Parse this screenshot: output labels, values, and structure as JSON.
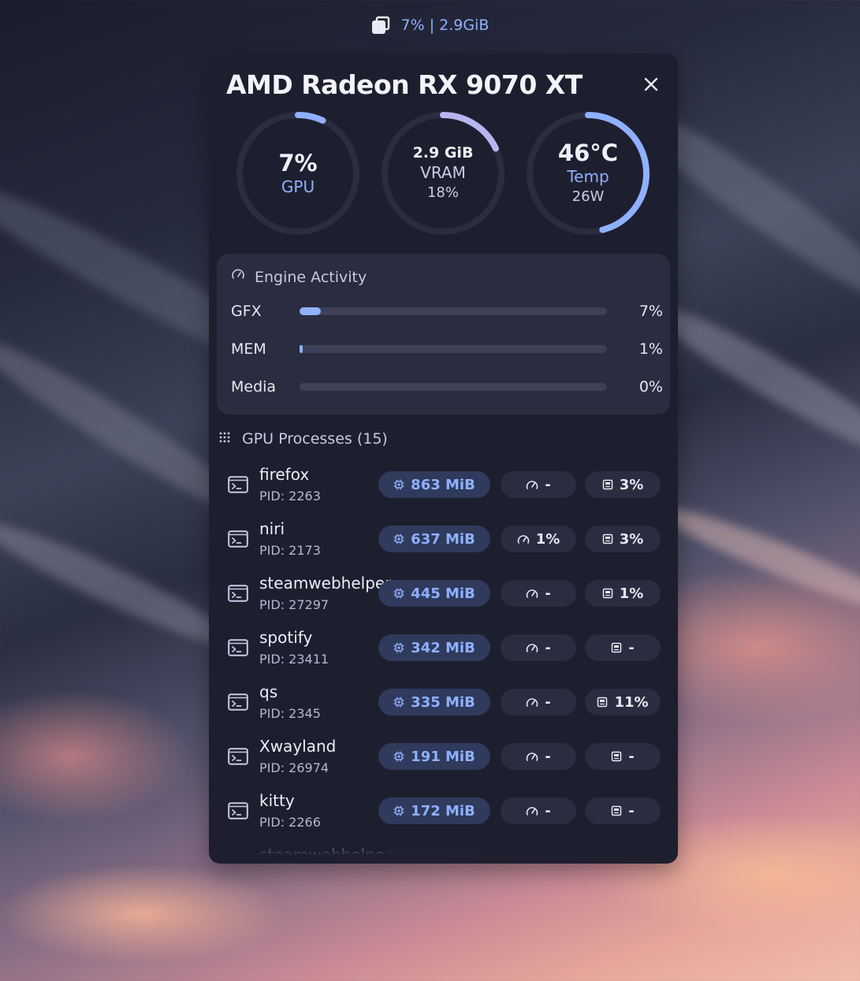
{
  "topbar": {
    "icon": "copy-window-icon",
    "text": "7% | 2.9GiB"
  },
  "panel": {
    "title": "AMD Radeon RX 9070 XT",
    "close_icon": "close-icon"
  },
  "gauges": [
    {
      "value": "7%",
      "label": "GPU",
      "fraction": 0.07
    },
    {
      "value": "2.9 GiB",
      "label": "VRAM",
      "sub": "18%",
      "fraction": 0.18
    },
    {
      "value": "46°C",
      "label": "Temp",
      "sub": "26W",
      "fraction": 0.46
    }
  ],
  "engine": {
    "title": "Engine Activity",
    "icon": "gauge-icon",
    "rows": [
      {
        "name": "GFX",
        "value": "7%",
        "fraction": 0.07
      },
      {
        "name": "MEM",
        "value": "1%",
        "fraction": 0.01
      },
      {
        "name": "Media",
        "value": "0%",
        "fraction": 0.0
      }
    ]
  },
  "processes": {
    "title": "GPU Processes (15)",
    "icon": "grid-dots-icon",
    "items": [
      {
        "name": "firefox",
        "pid": "PID: 2263",
        "mem": "863 MiB",
        "eng": "-",
        "gfx": "3%"
      },
      {
        "name": "niri",
        "pid": "PID: 2173",
        "mem": "637 MiB",
        "eng": "1%",
        "gfx": "3%"
      },
      {
        "name": "steamwebhelper",
        "pid": "PID: 27297",
        "mem": "445 MiB",
        "eng": "-",
        "gfx": "1%"
      },
      {
        "name": "spotify",
        "pid": "PID: 23411",
        "mem": "342 MiB",
        "eng": "-",
        "gfx": "-"
      },
      {
        "name": "qs",
        "pid": "PID: 2345",
        "mem": "335 MiB",
        "eng": "-",
        "gfx": "11%"
      },
      {
        "name": "Xwayland",
        "pid": "PID: 26974",
        "mem": "191 MiB",
        "eng": "-",
        "gfx": "-"
      },
      {
        "name": "kitty",
        "pid": "PID: 2266",
        "mem": "172 MiB",
        "eng": "-",
        "gfx": "-"
      },
      {
        "name": "steamwebhelper",
        "pid": "",
        "mem": "",
        "eng": "",
        "gfx": ""
      }
    ]
  },
  "colors": {
    "accent": "#8fb0ff",
    "vram_arc": "#b8b6f0",
    "panel_bg": "#1e1f2e",
    "card_bg": "#2a2c3f"
  }
}
